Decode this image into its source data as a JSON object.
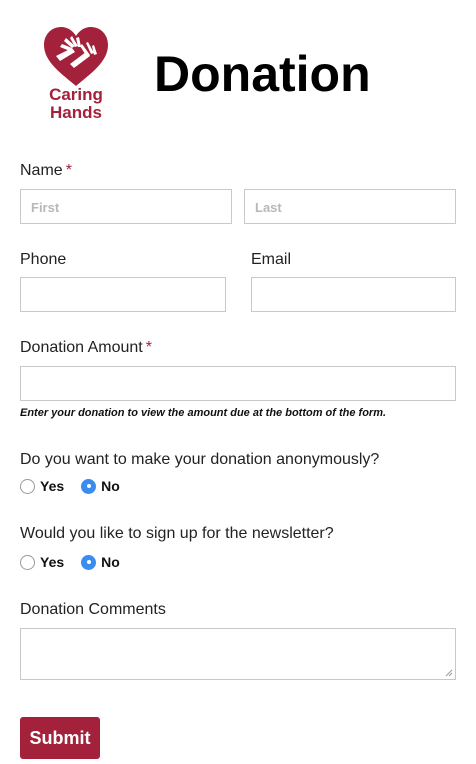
{
  "header": {
    "logo_line1": "Caring",
    "logo_line2": "Hands",
    "title": "Donation"
  },
  "name": {
    "label": "Name",
    "required": "*",
    "first_placeholder": "First",
    "last_placeholder": "Last"
  },
  "phone": {
    "label": "Phone"
  },
  "email": {
    "label": "Email"
  },
  "amount": {
    "label": "Donation Amount",
    "required": "*",
    "help": "Enter your donation to view the amount due at the bottom of the form."
  },
  "anonymous": {
    "question": "Do you want to make your donation anonymously?",
    "options": [
      "Yes",
      "No"
    ],
    "selected": "No"
  },
  "newsletter": {
    "question": "Would you like to sign up for the newsletter?",
    "options": [
      "Yes",
      "No"
    ],
    "selected": "No"
  },
  "comments": {
    "label": "Donation Comments"
  },
  "submit_label": "Submit",
  "colors": {
    "brand": "#a3213a",
    "radio_selected": "#3b8bf0"
  }
}
